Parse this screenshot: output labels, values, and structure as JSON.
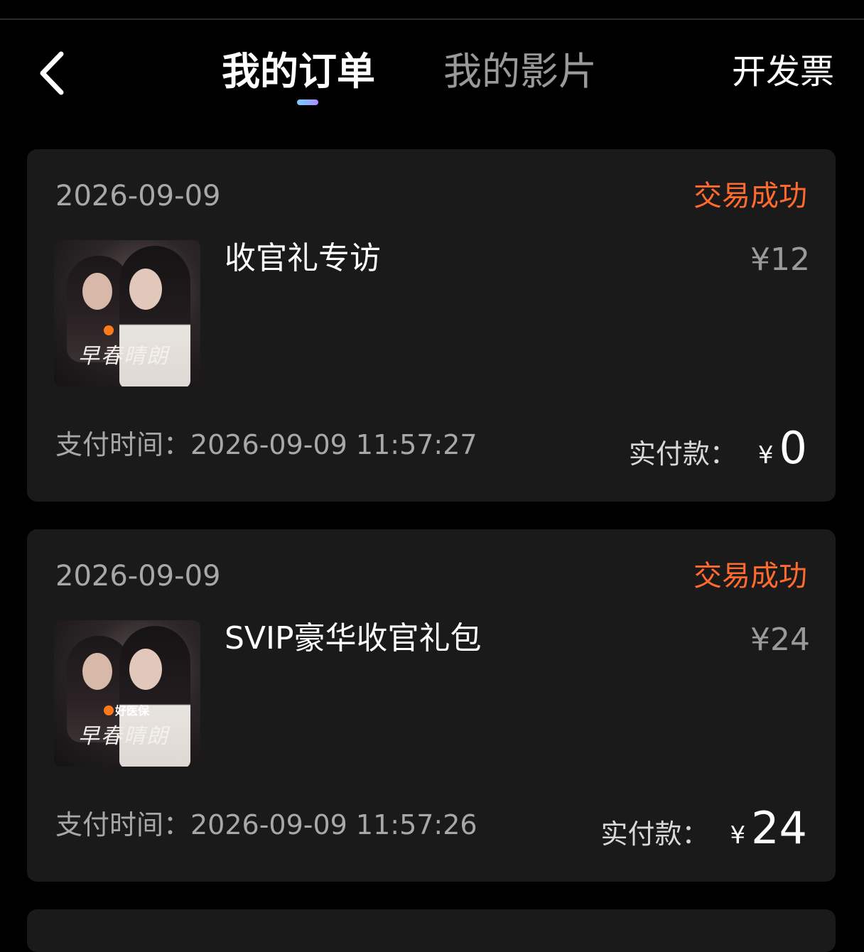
{
  "header": {
    "tabs": [
      {
        "label": "我的订单",
        "active": true
      },
      {
        "label": "我的影片",
        "active": false
      }
    ],
    "invoice_label": "开发票",
    "accent_color": "#ff6a2e"
  },
  "orders": [
    {
      "date": "2026-09-09",
      "status": "交易成功",
      "title": "收官礼专访",
      "price": "¥12",
      "pay_time": "支付时间：2026-09-09 11:57:27",
      "paid_label": "实付款：",
      "paid_currency": "¥",
      "paid_amount": "0",
      "poster_title": "早春晴朗",
      "poster_brand": ""
    },
    {
      "date": "2026-09-09",
      "status": "交易成功",
      "title": "SVIP豪华收官礼包",
      "price": "¥24",
      "pay_time": "支付时间：2026-09-09 11:57:26",
      "paid_label": "实付款：",
      "paid_currency": "¥",
      "paid_amount": "24",
      "poster_title": "早春晴朗",
      "poster_brand": "好医保"
    }
  ]
}
